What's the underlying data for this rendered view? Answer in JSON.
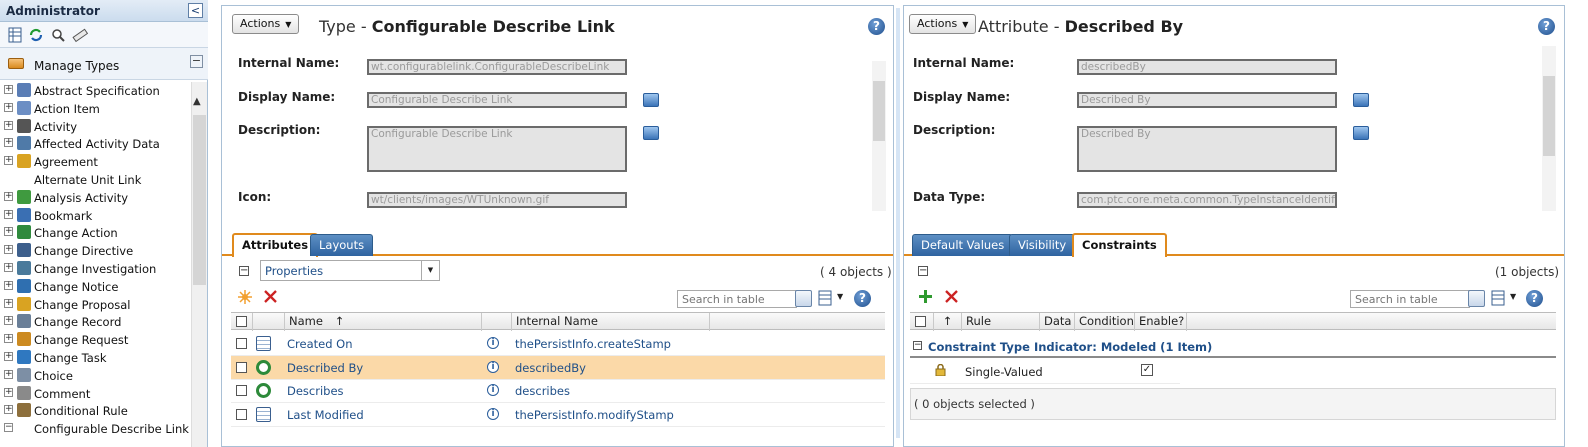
{
  "sidebar": {
    "title": "Administrator",
    "collapse_glyph": "<",
    "tools": [
      "table-icon",
      "refresh-icon",
      "search-tool-icon",
      "ruler-icon"
    ],
    "manage_label": "Manage Types",
    "manage_min": "−",
    "tree": [
      {
        "label": "Abstract Specification",
        "expand": "+",
        "icon": "spec-icon",
        "color": "#5a7db5"
      },
      {
        "label": "Action Item",
        "expand": "+",
        "icon": "action-item-icon",
        "color": "#6c8ec4"
      },
      {
        "label": "Activity",
        "expand": "+",
        "icon": "activity-icon",
        "color": "#555555"
      },
      {
        "label": "Affected Activity Data",
        "expand": "+",
        "icon": "affected-data-icon",
        "color": "#4f7aa8"
      },
      {
        "label": "Agreement",
        "expand": "+",
        "icon": "agreement-icon",
        "color": "#d9a322"
      },
      {
        "label": "Alternate Unit Link",
        "expand": "",
        "icon": "",
        "color": ""
      },
      {
        "label": "Analysis Activity",
        "expand": "+",
        "icon": "analysis-icon",
        "color": "#3f9a3f"
      },
      {
        "label": "Bookmark",
        "expand": "+",
        "icon": "bookmark-icon",
        "color": "#3a6fb3"
      },
      {
        "label": "Change Action",
        "expand": "+",
        "icon": "change-action-icon",
        "color": "#2f8a3d"
      },
      {
        "label": "Change Directive",
        "expand": "+",
        "icon": "change-directive-icon",
        "color": "#3d5f8c"
      },
      {
        "label": "Change Investigation",
        "expand": "+",
        "icon": "change-investigation-icon",
        "color": "#4a7a9b"
      },
      {
        "label": "Change Notice",
        "expand": "+",
        "icon": "change-notice-icon",
        "color": "#2f6fb0"
      },
      {
        "label": "Change Proposal",
        "expand": "+",
        "icon": "change-proposal-icon",
        "color": "#d9a322"
      },
      {
        "label": "Change Record",
        "expand": "+",
        "icon": "change-record-icon",
        "color": "#6a7f98"
      },
      {
        "label": "Change Request",
        "expand": "+",
        "icon": "change-request-icon",
        "color": "#cc8a20"
      },
      {
        "label": "Change Task",
        "expand": "+",
        "icon": "change-task-icon",
        "color": "#2f78c0"
      },
      {
        "label": "Choice",
        "expand": "+",
        "icon": "choice-icon",
        "color": "#7d8fa5"
      },
      {
        "label": "Comment",
        "expand": "+",
        "icon": "comment-icon",
        "color": "#8a8a8a"
      },
      {
        "label": "Conditional Rule",
        "expand": "+",
        "icon": "conditional-rule-icon",
        "color": "#8d6f3c"
      },
      {
        "label": "Configurable Describe Link",
        "expand": "−",
        "icon": "",
        "color": ""
      }
    ]
  },
  "left": {
    "actions_label": "Actions",
    "title_prefix": "Type - ",
    "title_name": "Configurable Describe Link",
    "help": "?",
    "fields": [
      {
        "label": "Internal Name:",
        "value": "wt.configurablelink.ConfigurableDescribeLink"
      },
      {
        "label": "Display Name:",
        "value": "Configurable Describe Link"
      },
      {
        "label": "Description:",
        "value": "Configurable Describe Link"
      },
      {
        "label": "Icon:",
        "value": "wt/clients/images/WTUnknown.gif"
      }
    ],
    "tabs": [
      "Attributes",
      "Layouts"
    ],
    "active_tab": "Attributes",
    "view_select": "Properties",
    "object_count": "( 4 objects )",
    "search_placeholder": "Search in table",
    "columns": [
      "Name",
      "Internal Name"
    ],
    "sort_glyph": "↑",
    "rows": [
      {
        "name": "Created On",
        "internal": "thePersistInfo.createStamp",
        "icon": "timestamp-icon",
        "selected": false
      },
      {
        "name": "Described By",
        "internal": "describedBy",
        "icon": "reference-icon",
        "selected": true
      },
      {
        "name": "Describes",
        "internal": "describes",
        "icon": "reference-icon",
        "selected": false
      },
      {
        "name": "Last Modified",
        "internal": "thePersistInfo.modifyStamp",
        "icon": "timestamp-icon",
        "selected": false
      }
    ]
  },
  "right": {
    "actions_label": "Actions",
    "title_prefix": "Attribute - ",
    "title_name": "Described By",
    "help": "?",
    "fields": [
      {
        "label": "Internal Name:",
        "value": "describedBy"
      },
      {
        "label": "Display Name:",
        "value": "Described By"
      },
      {
        "label": "Description:",
        "value": "Described By"
      },
      {
        "label": "Data Type:",
        "value": "com.ptc.core.meta.common.TypeInstanceIdentifier"
      }
    ],
    "tabs": [
      "Default Values",
      "Visibility",
      "Constraints"
    ],
    "active_tab": "Constraints",
    "object_count": "(1 objects)",
    "search_placeholder": "Search in table",
    "columns": [
      "↑",
      "Rule",
      "Data",
      "Condition",
      "Enable?"
    ],
    "group_label": "Constraint Type Indicator: Modeled (1 Item)",
    "rows": [
      {
        "rule": "Single-Valued",
        "enabled": true
      }
    ],
    "footer": "( 0 objects selected )"
  },
  "colors": {
    "accent_orange": "#e08a1d",
    "tab_blue": "#2e63a0",
    "link_blue": "#1f4f88",
    "selected_row": "#fbd9a8"
  }
}
